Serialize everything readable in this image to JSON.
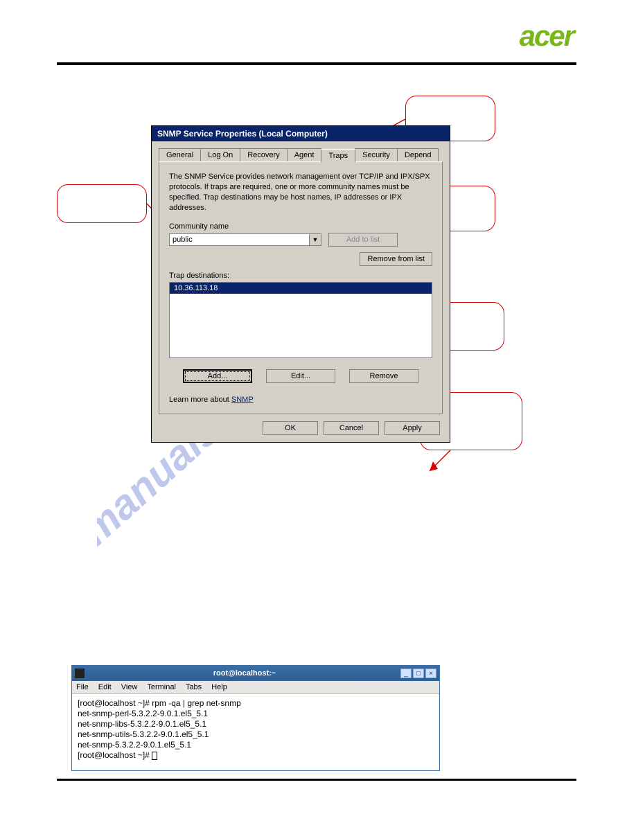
{
  "brand": "acer",
  "dialog": {
    "title": "SNMP Service Properties (Local Computer)",
    "tabs": [
      "General",
      "Log On",
      "Recovery",
      "Agent",
      "Traps",
      "Security",
      "Depend"
    ],
    "active_tab": "Traps",
    "description": "The SNMP Service provides network management over TCP/IP and IPX/SPX protocols. If traps are required, one or more community names must be specified. Trap destinations may be host names, IP addresses or IPX addresses.",
    "community_label": "Community name",
    "community_value": "public",
    "add_to_list": "Add to list",
    "remove_from_list": "Remove from list",
    "trap_dest_label": "Trap destinations:",
    "trap_items": [
      "10.36.113.18"
    ],
    "btn_add": "Add...",
    "btn_edit": "Edit...",
    "btn_remove": "Remove",
    "learn_prefix": "Learn more about ",
    "learn_link": "SNMP",
    "btn_ok": "OK",
    "btn_cancel": "Cancel",
    "btn_apply": "Apply"
  },
  "terminal": {
    "title": "root@localhost:~",
    "menu": [
      "File",
      "Edit",
      "View",
      "Terminal",
      "Tabs",
      "Help"
    ],
    "lines": [
      "[root@localhost ~]# rpm -qa | grep net-snmp",
      "net-snmp-perl-5.3.2.2-9.0.1.el5_5.1",
      "net-snmp-libs-5.3.2.2-9.0.1.el5_5.1",
      "net-snmp-utils-5.3.2.2-9.0.1.el5_5.1",
      "net-snmp-5.3.2.2-9.0.1.el5_5.1",
      "[root@localhost ~]# "
    ]
  },
  "watermark": "manualshive.com"
}
